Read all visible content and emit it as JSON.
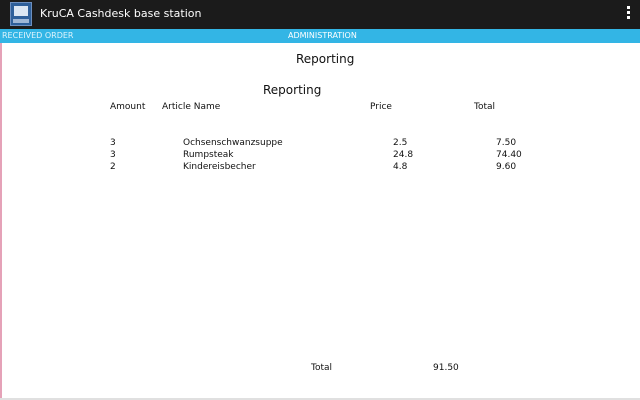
{
  "app": {
    "title": "KruCA Cashdesk base station",
    "icon": "cashdesk-app-icon",
    "menu_icon": "overflow-menu-icon"
  },
  "tabs": [
    {
      "label": "RECEIVED ORDER",
      "selected": false
    },
    {
      "label": "ADMINISTRATION",
      "selected": true
    }
  ],
  "colors": {
    "action_bar": "#1b1b1b",
    "tab_bar": "#33b5e5",
    "left_edge": "#e5a2b8"
  },
  "page": {
    "title": "Reporting"
  },
  "report": {
    "title": "Reporting",
    "headers": {
      "amount": "Amount",
      "article": "Article Name",
      "price": "Price",
      "total": "Total"
    },
    "rows": [
      {
        "amount": "3",
        "article": "Ochsenschwanzsuppe",
        "price": "2.5",
        "total": "7.50"
      },
      {
        "amount": "3",
        "article": "Rumpsteak",
        "price": "24.8",
        "total": "74.40"
      },
      {
        "amount": "2",
        "article": "Kindereisbecher",
        "price": "4.8",
        "total": "9.60"
      }
    ],
    "sum_label": "Total",
    "sum_value": "91.50"
  }
}
